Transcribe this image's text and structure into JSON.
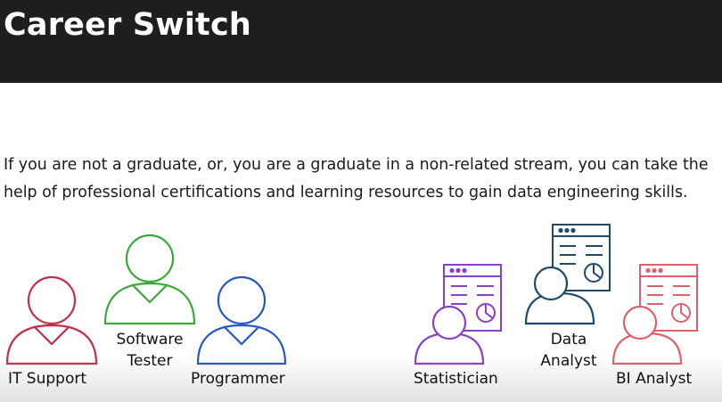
{
  "slide": {
    "title": "Career Switch",
    "body_line1": "If you are not a graduate, or, you are a graduate in a non-related stream, you can take the",
    "body_line2": "help of professional certifications and learning resources to gain data engineering skills."
  },
  "roles": {
    "it_support": {
      "label": "IT Support",
      "color": "#c0304a"
    },
    "software_tester": {
      "label_line1": "Software",
      "label_line2": "Tester",
      "color": "#3aa83a"
    },
    "programmer": {
      "label": "Programmer",
      "color": "#2456c8"
    },
    "statistician": {
      "label": "Statistician",
      "color": "#8a3fc8"
    },
    "data_analyst": {
      "label_line1": "Data",
      "label_line2": "Analyst",
      "color": "#1e4a6a"
    },
    "bi_analyst": {
      "label": "BI Analyst",
      "color": "#e0606e"
    }
  },
  "colors": {
    "header_bg": "#1e1e1e",
    "text": "#1a1a1a"
  }
}
